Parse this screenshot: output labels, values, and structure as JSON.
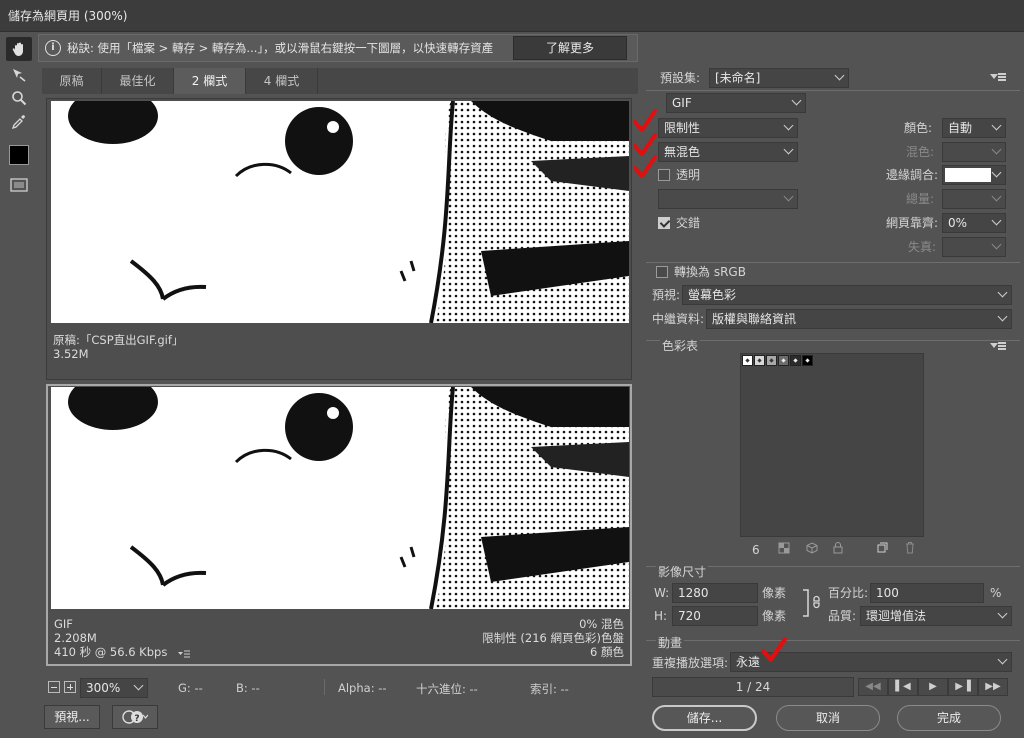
{
  "window": {
    "title": "儲存為網頁用 (300%)"
  },
  "tip": {
    "text": "秘訣: 使用「檔案 > 轉存 > 轉存為...」，或以滑鼠右鍵按一下圖層，以快速轉存資產",
    "button": "了解更多"
  },
  "tabs": [
    {
      "label": "原稿",
      "active": false
    },
    {
      "label": "最佳化",
      "active": false
    },
    {
      "label": "2 欄式",
      "active": true
    },
    {
      "label": "4 欄式",
      "active": false
    }
  ],
  "original_pane": {
    "name": "原稿:「CSP直出GIF.gif」",
    "size": "3.52M"
  },
  "optimized_pane": {
    "format": "GIF",
    "size": "2.208M",
    "time": "410 秒 @ 56.6 Kbps",
    "dither": "0% 混色",
    "palette": "限制性 (216 網頁色彩)色盤",
    "colors": "6 顏色"
  },
  "status": {
    "zoom": "300%",
    "g": "G: --",
    "b": "B: --",
    "alpha": "Alpha: --",
    "hex": "十六進位: --",
    "index": "索引: --"
  },
  "bottom_buttons": {
    "preview": "預視...",
    "save": "儲存...",
    "cancel": "取消",
    "done": "完成"
  },
  "settings": {
    "preset_label": "預設集:",
    "preset_value": "[未命名]",
    "format": "GIF",
    "reduction": "限制性",
    "dither_algo": "無混色",
    "transparency_label": "透明",
    "matte_empty": "",
    "interlaced_label": "交錯",
    "colors_label": "顏色:",
    "colors_value": "自動",
    "dither_label": "混色:",
    "matte_label": "邊緣調合:",
    "amount_label": "總量:",
    "web_snap_label": "網頁靠齊:",
    "web_snap_value": "0%",
    "lossy_label": "失真:",
    "srgb_label": "轉換為 sRGB",
    "preview_label": "預視:",
    "preview_value": "螢幕色彩",
    "metadata_label": "中繼資料:",
    "metadata_value": "版權與聯絡資訊"
  },
  "color_table": {
    "title": "色彩表",
    "count": "6",
    "swatches": [
      "#ffffff",
      "#d8d8d8",
      "#a8a8a8",
      "#6c6c6c",
      "#2c2c2c",
      "#000000"
    ]
  },
  "image_size": {
    "title": "影像尺寸",
    "w_label": "W:",
    "w_value": "1280",
    "w_unit": "像素",
    "h_label": "H:",
    "h_value": "720",
    "h_unit": "像素",
    "percent_label": "百分比:",
    "percent_value": "100",
    "percent_unit": "%",
    "quality_label": "品質:",
    "quality_value": "環迴增值法"
  },
  "animation": {
    "title": "動畫",
    "loop_label": "重複播放選項:",
    "loop_value": "永遠",
    "frame": "1 / 24"
  },
  "colors": {
    "annotation_red": "#e01010",
    "panel_bg": "#535353"
  }
}
